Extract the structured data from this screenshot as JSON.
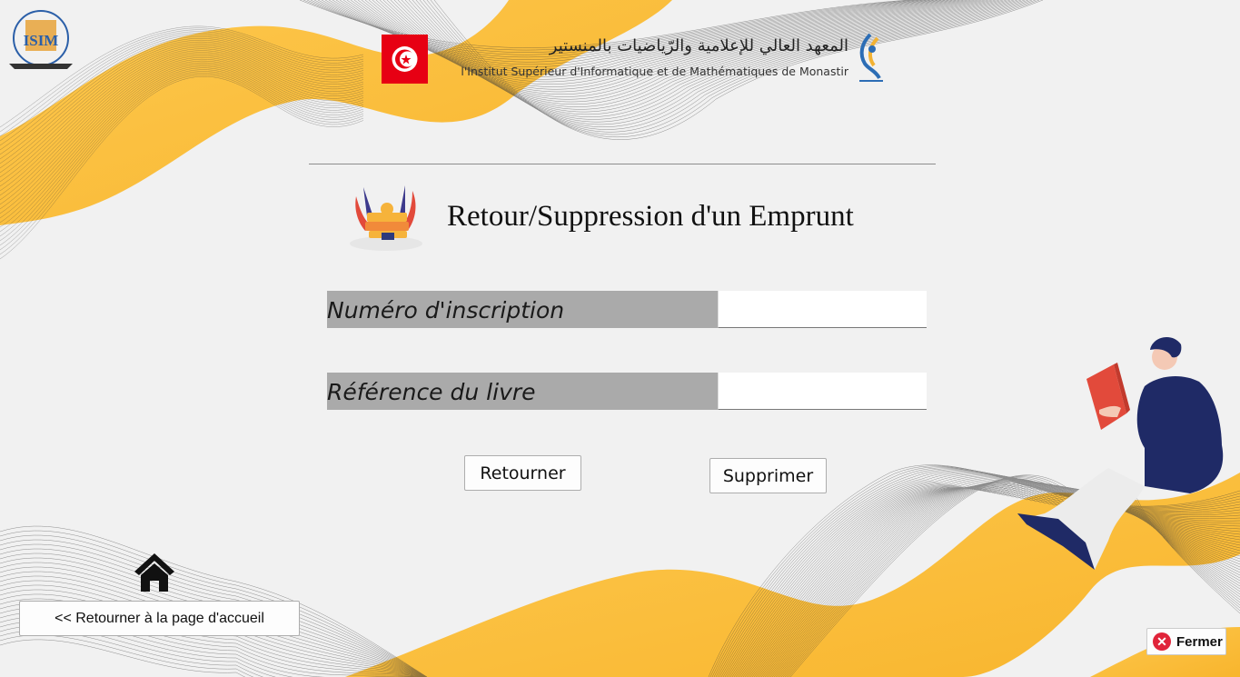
{
  "header": {
    "institute_arabic": "المعهد العالي للإعلامية والرّياضيات بالمنستير",
    "institute_french": "l'Institut Supérieur d'Informatique et de Mathématiques de Monastir",
    "left_logo_text": "ISIM"
  },
  "page": {
    "title": "Retour/Suppression d'un Emprunt"
  },
  "form": {
    "numero_label": "Numéro d'inscription",
    "numero_value": "",
    "reference_label": "Référence du livre",
    "reference_value": ""
  },
  "actions": {
    "retourner_label": "Retourner",
    "supprimer_label": "Supprimer",
    "home_label": "<< Retourner à la page d'accueil",
    "fermer_label": "Fermer"
  },
  "icons": [
    "isim-logo",
    "tunisia-flag",
    "university-logo",
    "books-icon",
    "home-icon",
    "close-icon",
    "reader-illustration"
  ],
  "colors": {
    "background": "#f1f1f1",
    "wave_yellow": "#fcc143",
    "label_gray": "#aaaaaa",
    "close_red": "#e0243a"
  }
}
